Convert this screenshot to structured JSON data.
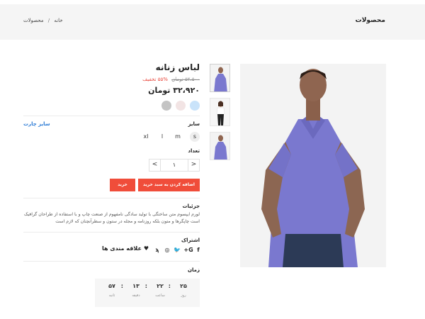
{
  "header": {
    "title": "محصولات",
    "breadcrumb": [
      "خانه",
      "محصولات"
    ],
    "separator": "/"
  },
  "product": {
    "title": "لباس زنانه",
    "old_price": "۵۲،۵۰۰ تومان",
    "discount": "%۵۵ تخفیف",
    "price": "۳۲،۹۲۰ تومان",
    "colors": [
      "#c4c4c4",
      "#f2e4e4",
      "#c9e3fa"
    ],
    "size_label": "سایز",
    "size_chart_label": "سایز چارت",
    "sizes": [
      "s",
      "m",
      "l",
      "xl"
    ],
    "selected_size": "s",
    "quantity_label": "تعداد",
    "quantity": "۱",
    "qty_increase": ">",
    "qty_decrease": "<",
    "add_to_cart_label": "اضافه کردن به سبد خرید",
    "buy_label": "خرید",
    "details_label": "جزئیات",
    "details_text": "لورم ایپسوم متن ساختگی با تولید سادگی نامفهوم از صنعت چاپ و با استفاده از طراحان گرافیک است چاپگرها و متون بلکه روزنامه و مجله در ستون و سطرآنچنان که لازم است",
    "share_label": "اشتراک",
    "social_icons": [
      "facebook-icon",
      "google-plus-icon",
      "twitter-icon",
      "instagram-icon",
      "rss-icon"
    ],
    "social_glyphs": {
      "facebook": "f",
      "google_plus": "G+",
      "twitter": "🐦",
      "instagram": "◎",
      "rss": "ϡ"
    },
    "wishlist_label": "علاقه مندی ها",
    "wishlist_icon": "heart-icon",
    "time_label": "زمان",
    "countdown": [
      {
        "value": "۲۵",
        "label": "روز"
      },
      {
        "value": "۲۲",
        "label": "ساعت"
      },
      {
        "value": "۱۳",
        "label": "دقیقه"
      },
      {
        "value": "۵۷",
        "label": "ثانیه"
      }
    ],
    "accent_color": "#f04d3a",
    "link_color": "#2a7ad5"
  }
}
